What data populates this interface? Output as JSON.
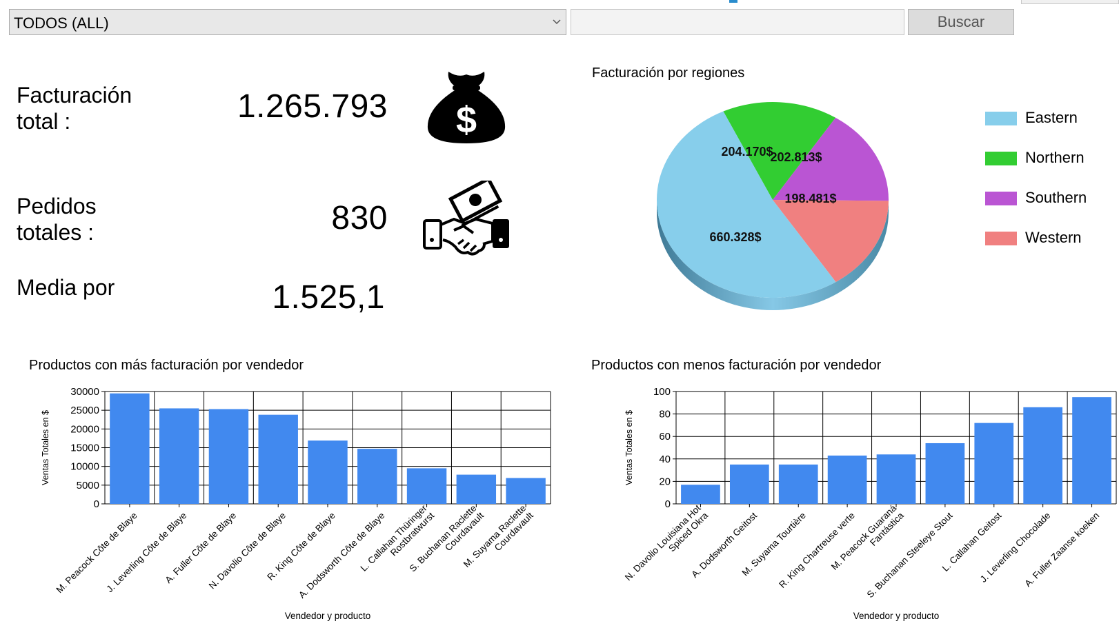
{
  "filter": {
    "selected": "TODOS (ALL)"
  },
  "search": {
    "value": "",
    "button_label": "Buscar"
  },
  "kpis": [
    {
      "label_line1": "Facturación",
      "label_line2": "total :",
      "value": "1.265.793",
      "icon": "money-bag-icon"
    },
    {
      "label_line1": "Pedidos",
      "label_line2": "totales :",
      "value": "830",
      "icon": "handshake-icon"
    },
    {
      "label_line1": "Media por",
      "label_line2": "",
      "value": "1.525,1",
      "icon": ""
    }
  ],
  "colors": {
    "bar": "#4189ef",
    "eastern": "#87ceeb",
    "northern": "#32cd32",
    "southern": "#ba55d3",
    "western": "#f08080"
  },
  "chart_data": [
    {
      "type": "pie",
      "title": "Facturación por regiones",
      "slices": [
        {
          "name": "Eastern",
          "value": 660328,
          "label": "660.328$"
        },
        {
          "name": "Northern",
          "value": 204170,
          "label": "204.170$"
        },
        {
          "name": "Southern",
          "value": 202813,
          "label": "202.813$"
        },
        {
          "name": "Western",
          "value": 198481,
          "label": "198.481$"
        }
      ],
      "legend_position": "right"
    },
    {
      "type": "bar",
      "title": "Productos con más facturación por vendedor",
      "xlabel": "Vendedor y producto",
      "ylabel": "Ventas Totales en $",
      "ylim": [
        0,
        30000
      ],
      "yticks": [
        "30000",
        "25000",
        "20000",
        "15000",
        "10000",
        "5000",
        "0"
      ],
      "grid": true,
      "categories": [
        [
          "M. Peacock Côte de Blaye"
        ],
        [
          "J. Leverling Côte de Blaye"
        ],
        [
          "A. Fuller Côte de Blaye"
        ],
        [
          "N. Davolio Côte de Blaye"
        ],
        [
          "R. King Côte de Blaye"
        ],
        [
          "A. Dodsworth Côte de Blaye"
        ],
        [
          "L. Callahan Thüringer",
          "Rostbratwurst"
        ],
        [
          "S. Buchanan Raclette",
          "Courdavault"
        ],
        [
          "M. Suyama Raclette",
          "Courdavault"
        ]
      ],
      "values": [
        29500,
        25500,
        25300,
        23800,
        16900,
        14700,
        9500,
        7800,
        6900
      ]
    },
    {
      "type": "bar",
      "title": "Productos con menos facturación por vendedor",
      "xlabel": "Vendedor y producto",
      "ylabel": "Ventas Totales en $",
      "ylim": [
        0,
        100
      ],
      "yticks": [
        "100",
        "80",
        "60",
        "40",
        "20",
        "0"
      ],
      "grid": true,
      "categories": [
        [
          "N. Davolio Louisiana Hot",
          "Spiced Okra"
        ],
        [
          "A. Dodsworth Geitost"
        ],
        [
          "M. Suyama Tourtière"
        ],
        [
          "R. King Chartreuse verte"
        ],
        [
          "M. Peacock Guaraná",
          "Fantástica"
        ],
        [
          "S. Buchanan Steeleye Stout"
        ],
        [
          "L. Callahan Geitost"
        ],
        [
          "J. Leverling Chocolade"
        ],
        [
          "A. Fuller Zaanse koeken"
        ]
      ],
      "values": [
        17,
        35,
        35,
        43,
        44,
        54,
        72,
        86,
        95
      ]
    }
  ]
}
